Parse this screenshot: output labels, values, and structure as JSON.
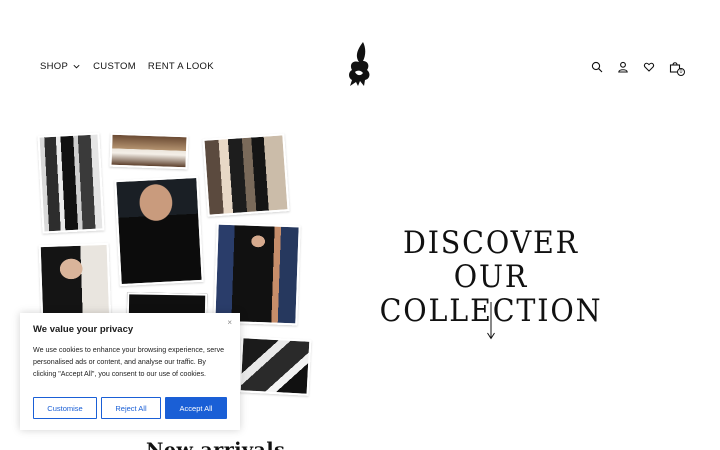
{
  "nav": {
    "items": [
      {
        "label": "SHOP",
        "has_dropdown": true
      },
      {
        "label": "CUSTOM"
      },
      {
        "label": "RENT A LOOK"
      }
    ]
  },
  "header": {
    "actions": {
      "icons": [
        "search-icon",
        "account-icon",
        "wishlist-icon",
        "cart-icon"
      ],
      "cart_count": "0"
    }
  },
  "hero": {
    "line1": "DISCOVER",
    "line2": "OUR COLLECTION"
  },
  "sections": {
    "new_arrivals_title": "New arrivals"
  },
  "cookie": {
    "title": "We value your privacy",
    "text": "We use cookies to enhance your browsing experience, serve personalised ads or content, and analyse our traffic. By clicking \"Accept All\", you consent to our use of cookies.",
    "close": "×",
    "buttons": {
      "customise": "Customise",
      "reject": "Reject All",
      "accept": "Accept All"
    }
  },
  "colors": {
    "accent": "#1a5fd6",
    "text": "#111111",
    "background": "#ffffff"
  }
}
